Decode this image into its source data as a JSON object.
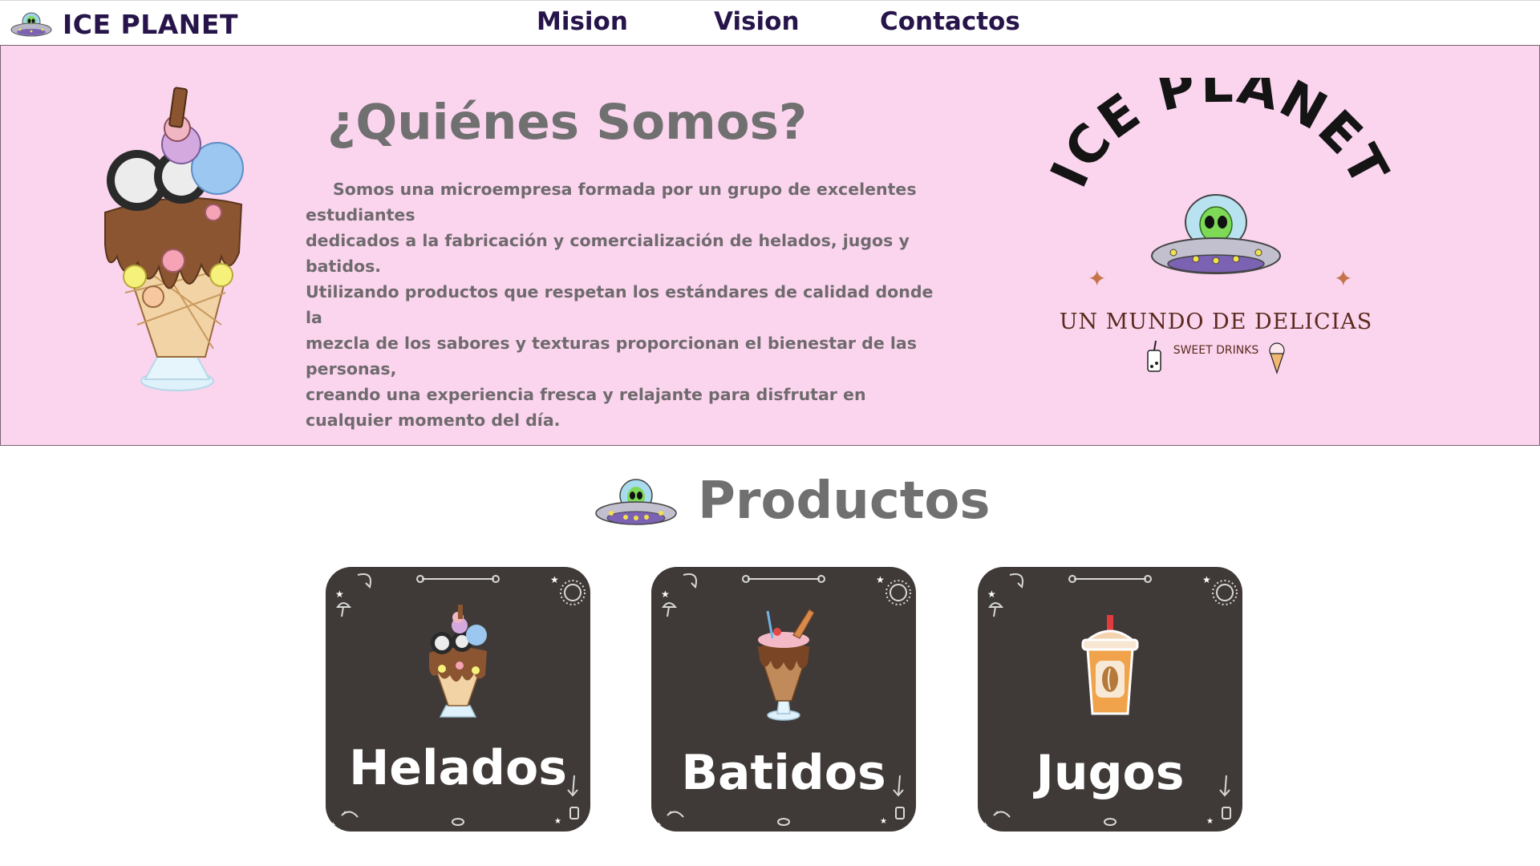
{
  "navbar": {
    "brand_name": "ICE PLANET",
    "links": [
      "Mision",
      "Vision",
      "Contactos"
    ]
  },
  "about": {
    "title": "¿Quiénes Somos?",
    "paragraph_lines": [
      "Somos una microempresa formada por un grupo de excelentes estudiantes",
      "dedicados a la fabricación y comercialización de helados, jugos y batidos.",
      "Utilizando productos que respetan los estándares de calidad donde la",
      "mezcla de los sabores y texturas proporcionan el bienestar de las personas,",
      "creando una experiencia fresca y relajante para disfrutar en",
      "cualquier momento del día."
    ],
    "logo": {
      "brand_arc": "ICE PLANET",
      "tagline": "UN MUNDO DE DELICIAS",
      "subtagline": "SWEET DRINKS"
    }
  },
  "products": {
    "title": "Productos",
    "cards": [
      {
        "label": "Helados",
        "icon": "ice-cream-sundae-icon"
      },
      {
        "label": "Batidos",
        "icon": "milkshake-icon"
      },
      {
        "label": "Jugos",
        "icon": "juice-cup-icon"
      }
    ]
  },
  "colors": {
    "about_bg": "#fbd5ee",
    "nav_text": "#26144a",
    "heading_gray": "#707070",
    "card_bg": "#3f3a37"
  }
}
